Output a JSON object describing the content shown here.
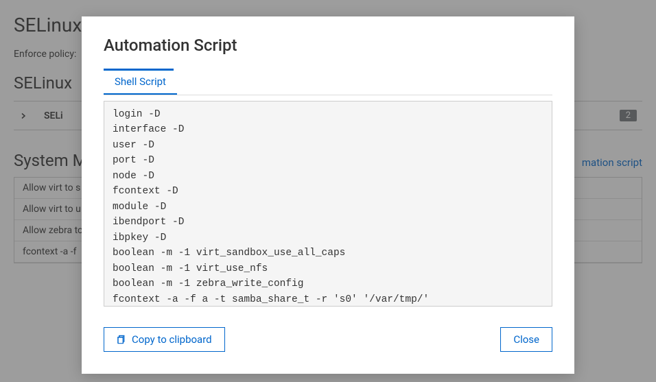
{
  "page": {
    "title": "SELinux",
    "enforce_label": "Enforce policy:",
    "section1_title": "SELinux",
    "selinux_item_label": "SELi",
    "badge_count": "2",
    "section2_title": "System M",
    "automation_link": "mation script",
    "table_rows": [
      "Allow virt to s",
      "Allow virt to u",
      "Allow zebra to",
      "fcontext -a -f"
    ]
  },
  "modal": {
    "title": "Automation Script",
    "tab_label": "Shell Script",
    "script_content": "login -D\ninterface -D\nuser -D\nport -D\nnode -D\nfcontext -D\nmodule -D\nibendport -D\nibpkey -D\nboolean -m -1 virt_sandbox_use_all_caps\nboolean -m -1 virt_use_nfs\nboolean -m -1 zebra_write_config\nfcontext -a -f a -t samba_share_t -r 's0' '/var/tmp/'",
    "copy_button": "Copy to clipboard",
    "close_button": "Close"
  }
}
